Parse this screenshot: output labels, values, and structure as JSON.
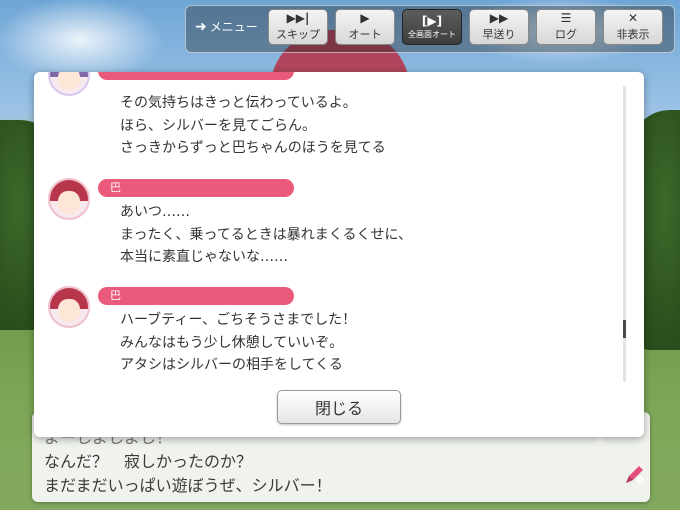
{
  "menu": {
    "label": "メニュー"
  },
  "toolbar": [
    {
      "icon": "▶▶|",
      "label": "スキップ",
      "active": false
    },
    {
      "icon": "▶",
      "label": "オート",
      "active": false
    },
    {
      "icon": "[▶]",
      "label": "全画面オート",
      "active": true
    },
    {
      "icon": "▶▶",
      "label": "早送り",
      "active": false
    },
    {
      "icon": "☰",
      "label": "ログ",
      "active": false
    },
    {
      "icon": "✕",
      "label": "非表示",
      "active": false
    }
  ],
  "log": {
    "entries": [
      {
        "speaker": "",
        "lines": [
          "その気持ちはきっと伝わっているよ。",
          "ほら、シルバーを見てごらん。",
          "さっきからずっと巴ちゃんのほうを見てる"
        ]
      },
      {
        "speaker": "巴",
        "lines": [
          "あいつ……",
          "まったく、乗ってるときは暴れまくるくせに、",
          "本当に素直じゃないな……"
        ]
      },
      {
        "speaker": "巴",
        "lines": [
          "ハーブティー、ごちそうさまでした！",
          "みんなはもう少し休憩していいぞ。",
          "アタシはシルバーの相手をしてくる"
        ]
      }
    ],
    "close_label": "閉じる"
  },
  "dialog": {
    "lines": [
      "よーしよしよし！",
      "なんだ？　寂しかったのか？",
      "まだまだいっぱい遊ぼうぜ、シルバー！"
    ]
  },
  "colors": {
    "accent": "#ea5a7a",
    "active_button": "#3d3d3d"
  }
}
